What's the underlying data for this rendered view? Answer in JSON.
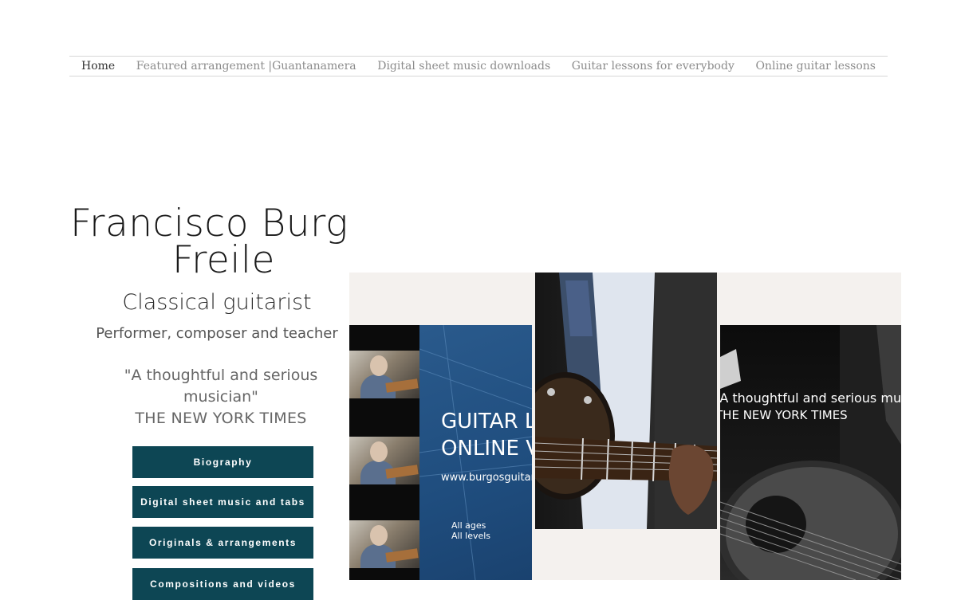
{
  "nav": {
    "items": [
      {
        "label": "Home",
        "active": true
      },
      {
        "label": "Featured arrangement |Guantanamera",
        "active": false
      },
      {
        "label": "Digital sheet music downloads",
        "active": false
      },
      {
        "label": "Guitar lessons for everybody",
        "active": false
      },
      {
        "label": "Online guitar lessons",
        "active": false
      }
    ]
  },
  "hero": {
    "name_line1": "Francisco Burgos",
    "name_line2": "Freile",
    "subtitle": "Classical guitarist",
    "tagline": "Performer, composer and teacher",
    "quote": "\"A thoughtful and serious musician\"",
    "quote_source": "THE NEW YORK TIMES"
  },
  "buttons": [
    {
      "label": "Biography"
    },
    {
      "label": "Digital sheet music and tabs"
    },
    {
      "label": "Originals & arrangements"
    },
    {
      "label": "Compositions and videos"
    }
  ],
  "collage": {
    "lesson_title_line1": "GUITAR LESSONS",
    "lesson_title_line2": "ONLINE VIA SKYPE",
    "lesson_url": "www.burgosguitar.com",
    "levels_line1": "All ages",
    "levels_line2": "All levels",
    "quote_text": "\"A thoughtful and serious musician\"",
    "quote_source": "THE NEW YORK TIMES"
  },
  "colors": {
    "button_bg": "#0d4654",
    "nav_text": "#8c8c8c",
    "nav_active": "#333333"
  }
}
